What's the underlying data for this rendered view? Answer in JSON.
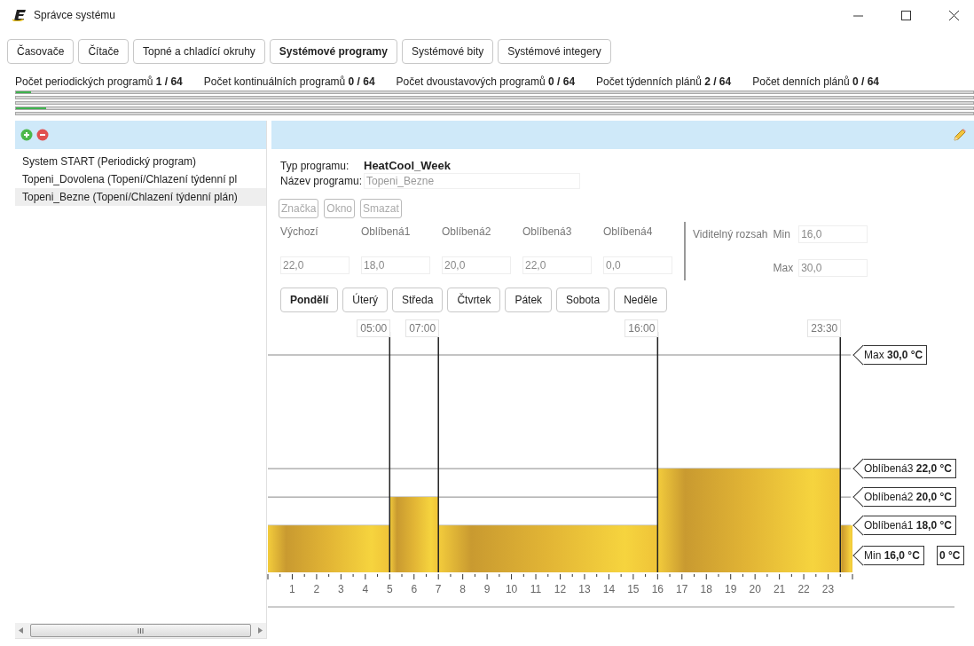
{
  "window": {
    "title": "Správce systému"
  },
  "tabs": [
    {
      "label": "Časovače",
      "selected": false
    },
    {
      "label": "Čítače",
      "selected": false
    },
    {
      "label": "Topné a chladící okruhy",
      "selected": false
    },
    {
      "label": "Systémové programy",
      "selected": true
    },
    {
      "label": "Systémové bity",
      "selected": false
    },
    {
      "label": "Systémové integery",
      "selected": false
    }
  ],
  "counters": [
    {
      "label": "Počet periodických programů",
      "value": "1 / 64"
    },
    {
      "label": "Počet kontinuálních programů",
      "value": "0 / 64"
    },
    {
      "label": "Počet dvoustavových programů",
      "value": "0 / 64"
    },
    {
      "label": "Počet týdenních plánů",
      "value": "2 / 64"
    },
    {
      "label": "Počet denních plánů",
      "value": "0 / 64"
    }
  ],
  "progress_bars": [
    {
      "kind": "filled",
      "level": 0.0156
    },
    {
      "kind": "empty"
    },
    {
      "kind": "empty"
    },
    {
      "kind": "filled",
      "level": 0.03125
    },
    {
      "kind": "empty"
    }
  ],
  "program_list": {
    "items": [
      {
        "label": "System START  (Periodický program)",
        "selected": false
      },
      {
        "label": "Topeni_Dovolena  (Topení/Chlazení týdenní pl",
        "selected": false
      },
      {
        "label": "Topeni_Bezne  (Topení/Chlazení týdenní plán)",
        "selected": true
      }
    ]
  },
  "detail": {
    "type_label": "Typ programu:",
    "type_value": "HeatCool_Week",
    "name_label": "Název programu:",
    "name_value": "Topeni_Bezne",
    "buttons": [
      {
        "label": "Značka",
        "disabled": true
      },
      {
        "label": "Okno",
        "disabled": true
      },
      {
        "label": "Smazat",
        "disabled": true
      }
    ],
    "temperatures": [
      {
        "label": "Výchozí",
        "value": "22,0"
      },
      {
        "label": "Oblíbená1",
        "value": "18,0"
      },
      {
        "label": "Oblíbená2",
        "value": "20,0"
      },
      {
        "label": "Oblíbená3",
        "value": "22,0"
      },
      {
        "label": "Oblíbená4",
        "value": "0,0"
      }
    ],
    "range": {
      "label": "Viditelný rozsah",
      "min_label": "Min",
      "min_value": "16,0",
      "max_label": "Max",
      "max_value": "30,0"
    },
    "days": [
      {
        "label": "Pondělí",
        "selected": true
      },
      {
        "label": "Úterý",
        "selected": false
      },
      {
        "label": "Středa",
        "selected": false
      },
      {
        "label": "Čtvrtek",
        "selected": false
      },
      {
        "label": "Pátek",
        "selected": false
      },
      {
        "label": "Sobota",
        "selected": false
      },
      {
        "label": "Neděle",
        "selected": false
      }
    ],
    "schedule": {
      "time_markers": [
        "05:00",
        "07:00",
        "16:00",
        "23:30"
      ],
      "overflow_label": "0 °C",
      "chart_data": {
        "type": "area",
        "x": [
          0,
          5,
          5,
          7,
          7,
          16,
          16,
          23.5,
          23.5,
          24
        ],
        "grid": true,
        "series": [
          {
            "color": "#e2b535",
            "values": [
              18,
              18,
              20,
              20,
              18,
              18,
              22,
              22,
              18,
              18
            ]
          }
        ],
        "xlim": [
          0,
          24
        ],
        "ylim": [
          14.7,
          30
        ],
        "xticks": [
          1,
          2,
          3,
          4,
          5,
          6,
          7,
          8,
          9,
          10,
          11,
          12,
          13,
          14,
          15,
          16,
          17,
          18,
          19,
          20,
          21,
          22,
          23
        ],
        "yticks": [
          {
            "value": 30,
            "label": "Max **30,0 °C**"
          },
          {
            "value": 22,
            "label": "Oblíbená3 **22,0 °C**"
          },
          {
            "value": 20,
            "label": "Oblíbená2 **20,0 °C**"
          },
          {
            "value": 18,
            "label": "Oblíbená1 **18,0 °C**"
          },
          {
            "value": 16,
            "label": "Min **16,0 °C**"
          }
        ]
      }
    }
  }
}
